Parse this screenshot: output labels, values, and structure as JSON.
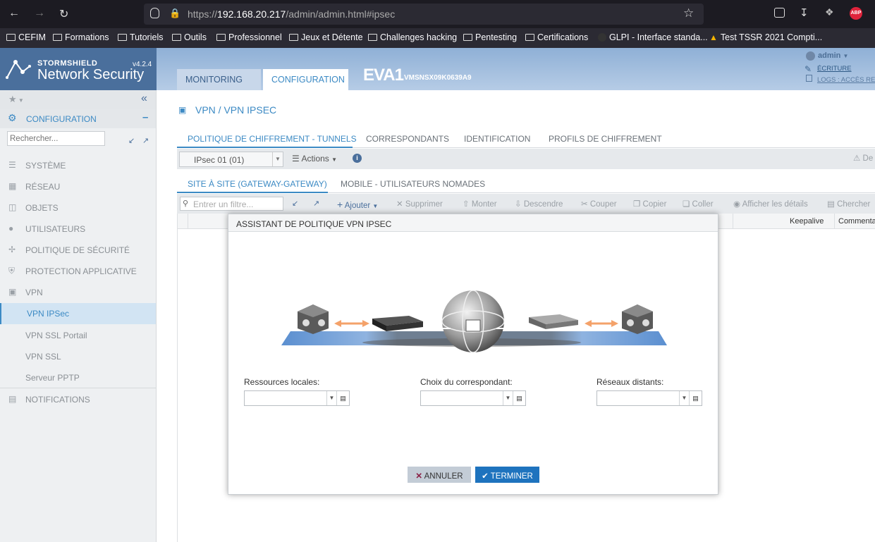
{
  "browser": {
    "url_prefix": "https://",
    "url_host": "192.168.20.217",
    "url_path": "/admin/admin.html#ipsec",
    "bookmarks": [
      "CEFIM",
      "Formations",
      "Tutoriels",
      "Outils",
      "Professionnel",
      "Jeux et Détente",
      "Challenges hacking",
      "Pentesting",
      "Certifications",
      "GLPI - Interface standa...",
      "Test TSSR 2021 Compti..."
    ]
  },
  "header": {
    "brand": "STORMSHIELD",
    "product": "Network Security",
    "version": "v4.2.4",
    "tabs": [
      "MONITORING",
      "CONFIGURATION"
    ],
    "device_name": "EVA1",
    "device_serial": "VMSNSX09K0639A9",
    "user": "admin",
    "write_mode": "ÉCRITURE",
    "logs_access": "LOGS : ACCÈS RES"
  },
  "sidebar": {
    "section": "CONFIGURATION",
    "search_placeholder": "Rechercher...",
    "items": [
      {
        "label": "SYSTÈME",
        "icon": "sliders-icon"
      },
      {
        "label": "RÉSEAU",
        "icon": "network-icon"
      },
      {
        "label": "OBJETS",
        "icon": "database-icon"
      },
      {
        "label": "UTILISATEURS",
        "icon": "user-icon"
      },
      {
        "label": "POLITIQUE DE SÉCURITÉ",
        "icon": "arrows-icon"
      },
      {
        "label": "PROTECTION APPLICATIVE",
        "icon": "shield-icon"
      },
      {
        "label": "VPN",
        "icon": "vpn-icon"
      }
    ],
    "vpn_sub": [
      "VPN IPSec",
      "VPN SSL Portail",
      "VPN SSL",
      "Serveur PPTP"
    ],
    "notifications": "NOTIFICATIONS"
  },
  "main": {
    "breadcrumb": "VPN / VPN IPSEC",
    "tabs": [
      "POLITIQUE DE CHIFFREMENT - TUNNELS",
      "CORRESPONDANTS",
      "IDENTIFICATION",
      "PROFILS DE CHIFFREMENT"
    ],
    "policy_select": "IPsec 01 (01)",
    "actions_label": "Actions",
    "right_cut": "De",
    "subtabs": [
      "SITE À SITE (GATEWAY-GATEWAY)",
      "MOBILE - UTILISATEURS NOMADES"
    ],
    "filter_placeholder": "Entrer un filtre...",
    "toolbar": [
      "Ajouter",
      "Supprimer",
      "Monter",
      "Descendre",
      "Couper",
      "Copier",
      "Coller",
      "Afficher les détails",
      "Chercher"
    ],
    "columns": [
      "Keepalive",
      "Commenta"
    ]
  },
  "modal": {
    "title": "ASSISTANT DE POLITIQUE VPN IPSEC",
    "local_label": "Ressources locales:",
    "peer_label": "Choix du correspondant:",
    "remote_label": "Réseaux distants:",
    "cancel": "ANNULER",
    "finish": "TERMINER"
  }
}
